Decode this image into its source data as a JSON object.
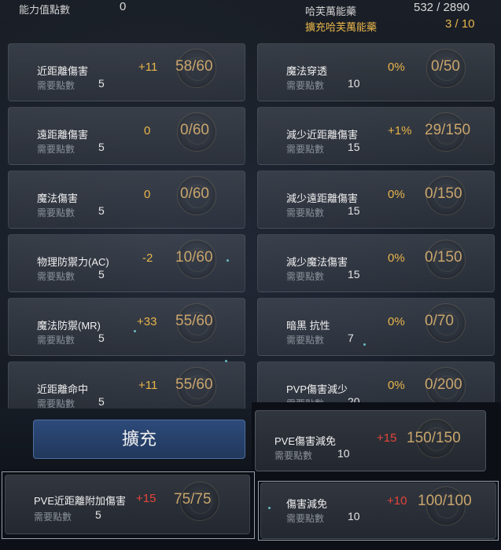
{
  "header": {
    "ability_points_label": "能力值點數",
    "ability_points_value": "0",
    "hafen_label": "哈芙萬能藥",
    "hafen_value": "532 / 2890",
    "expand_hafen_label": "擴充哈芙萬能藥",
    "expand_hafen_value": "3 / 10"
  },
  "required_label": "需要點數",
  "left_stats": [
    {
      "name": "近距離傷害",
      "bonus": "+11",
      "progress": "58/60",
      "required": "5"
    },
    {
      "name": "遠距離傷害",
      "bonus": "0",
      "progress": "0/60",
      "required": "5"
    },
    {
      "name": "魔法傷害",
      "bonus": "0",
      "progress": "0/60",
      "required": "5"
    },
    {
      "name": "物理防禦力(AC)",
      "bonus": "-2",
      "progress": "10/60",
      "required": "5"
    },
    {
      "name": "魔法防禦(MR)",
      "bonus": "+33",
      "progress": "55/60",
      "required": "5"
    },
    {
      "name": "近距離命中",
      "bonus": "+11",
      "progress": "55/60",
      "required": "5"
    }
  ],
  "right_stats": [
    {
      "name": "魔法穿透",
      "bonus": "0%",
      "progress": "0/50",
      "required": "10"
    },
    {
      "name": "減少近距離傷害",
      "bonus": "+1%",
      "progress": "29/150",
      "required": "15"
    },
    {
      "name": "減少遠距離傷害",
      "bonus": "0%",
      "progress": "0/150",
      "required": "15"
    },
    {
      "name": "減少魔法傷害",
      "bonus": "0%",
      "progress": "0/150",
      "required": "15"
    },
    {
      "name": "暗黑 抗性",
      "bonus": "0%",
      "progress": "0/70",
      "required": "7"
    },
    {
      "name": "PVP傷害減少",
      "bonus": "0%",
      "progress": "0/200",
      "required": "20"
    }
  ],
  "expand_button": "擴充",
  "extra_cards": [
    {
      "name": "PVE傷害減免",
      "bonus": "+15",
      "progress": "150/150",
      "required": "10"
    },
    {
      "name": "PVE近距離附加傷害",
      "bonus": "+15",
      "progress": "75/75",
      "required": "5"
    },
    {
      "name": "傷害減免",
      "bonus": "+10",
      "progress": "100/100",
      "required": "10"
    }
  ]
}
